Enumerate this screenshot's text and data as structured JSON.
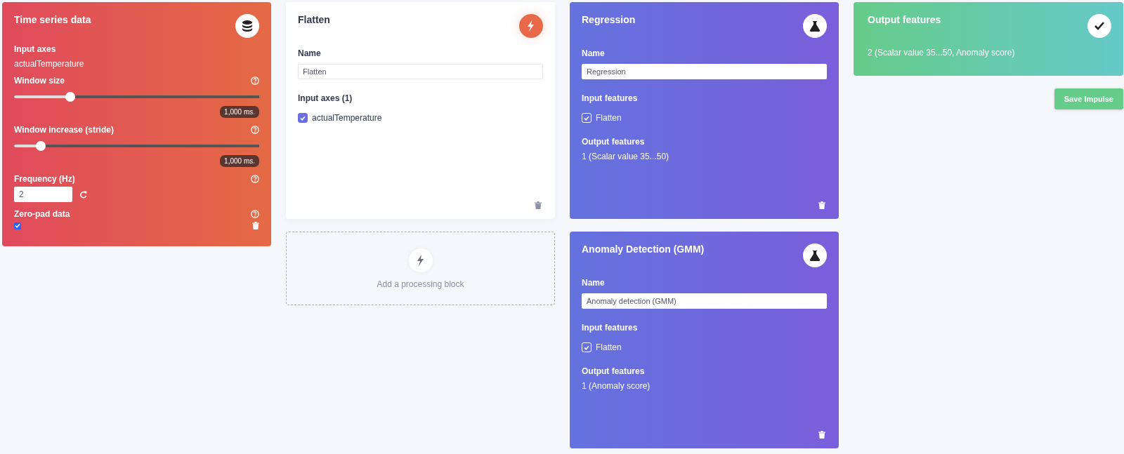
{
  "time_series": {
    "title": "Time series data",
    "input_axes_label": "Input axes",
    "input_axes_value": "actualTemperature",
    "sliders": [
      {
        "label": "Window size",
        "level": 0.23,
        "reading": "1,000 ms."
      },
      {
        "label": "Window increase (stride)",
        "level": 0.11,
        "reading": "1,000 ms."
      }
    ],
    "frequency": {
      "label": "Frequency (Hz)",
      "value": "2"
    },
    "zero_pad": {
      "label": "Zero-pad data",
      "checked": true
    }
  },
  "processing": {
    "title": "Flatten",
    "name_label": "Name",
    "name_value": "Flatten",
    "input_axes_label": "Input axes (1)",
    "axes": [
      {
        "name": "actualTemperature",
        "checked": true
      }
    ]
  },
  "add_block": {
    "label": "Add a processing block"
  },
  "learning_blocks": [
    {
      "title": "Regression",
      "name_label": "Name",
      "name_value": "Regression",
      "input_label": "Input features",
      "inputs": [
        {
          "name": "Flatten",
          "checked": true
        }
      ],
      "output_label": "Output features",
      "output_value": "1 (Scalar value 35...50)"
    },
    {
      "title": "Anomaly Detection (GMM)",
      "name_label": "Name",
      "name_value": "Anomaly detection (GMM)",
      "input_label": "Input features",
      "inputs": [
        {
          "name": "Flatten",
          "checked": true
        }
      ],
      "output_label": "Output features",
      "output_value": "1 (Anomaly score)"
    }
  ],
  "output": {
    "title": "Output features",
    "value": "2 (Scalar value 35...50, Anomaly score)"
  },
  "save_button": "Save Impulse"
}
